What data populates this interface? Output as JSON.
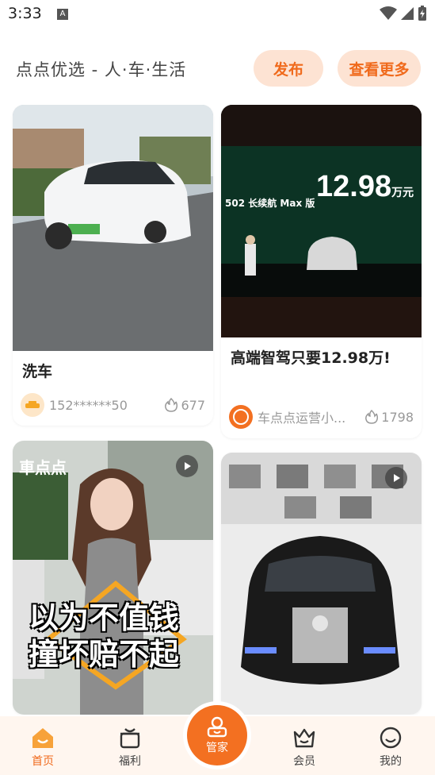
{
  "status_bar": {
    "time": "3:33",
    "notification_letter": "A"
  },
  "header": {
    "brand": "点点优选 - 人·车·生活",
    "publish_label": "发布",
    "more_label": "查看更多"
  },
  "feed": {
    "cards": [
      {
        "title": "洗车",
        "author": "152******50",
        "likes": "677",
        "image": "white-tesla-photo"
      },
      {
        "title": "高端智驾只要12.98万!",
        "author": "车点点运营小...",
        "likes": "1798",
        "image": "launch-event-photo",
        "image_text": {
          "price": "12.98",
          "unit": "万元",
          "model": "502 长续航 Max 版"
        }
      },
      {
        "image": "woman-video-thumbnail",
        "overlay": {
          "logo": "車点点",
          "line1": "以为不值钱",
          "line2": "撞坏赔不起"
        }
      },
      {
        "image": "black-van-video-thumbnail"
      }
    ]
  },
  "bottom_nav": {
    "items": [
      {
        "label": "首页",
        "icon": "home-icon",
        "active": true
      },
      {
        "label": "福利",
        "icon": "gift-icon"
      },
      {
        "label": "管家",
        "icon": "steward-icon"
      },
      {
        "label": "会员",
        "icon": "crown-icon"
      },
      {
        "label": "我的",
        "icon": "smile-icon"
      }
    ]
  },
  "colors": {
    "accent": "#f37021",
    "pill_bg": "#fde3d3",
    "nav_bg": "#fff6ef"
  }
}
